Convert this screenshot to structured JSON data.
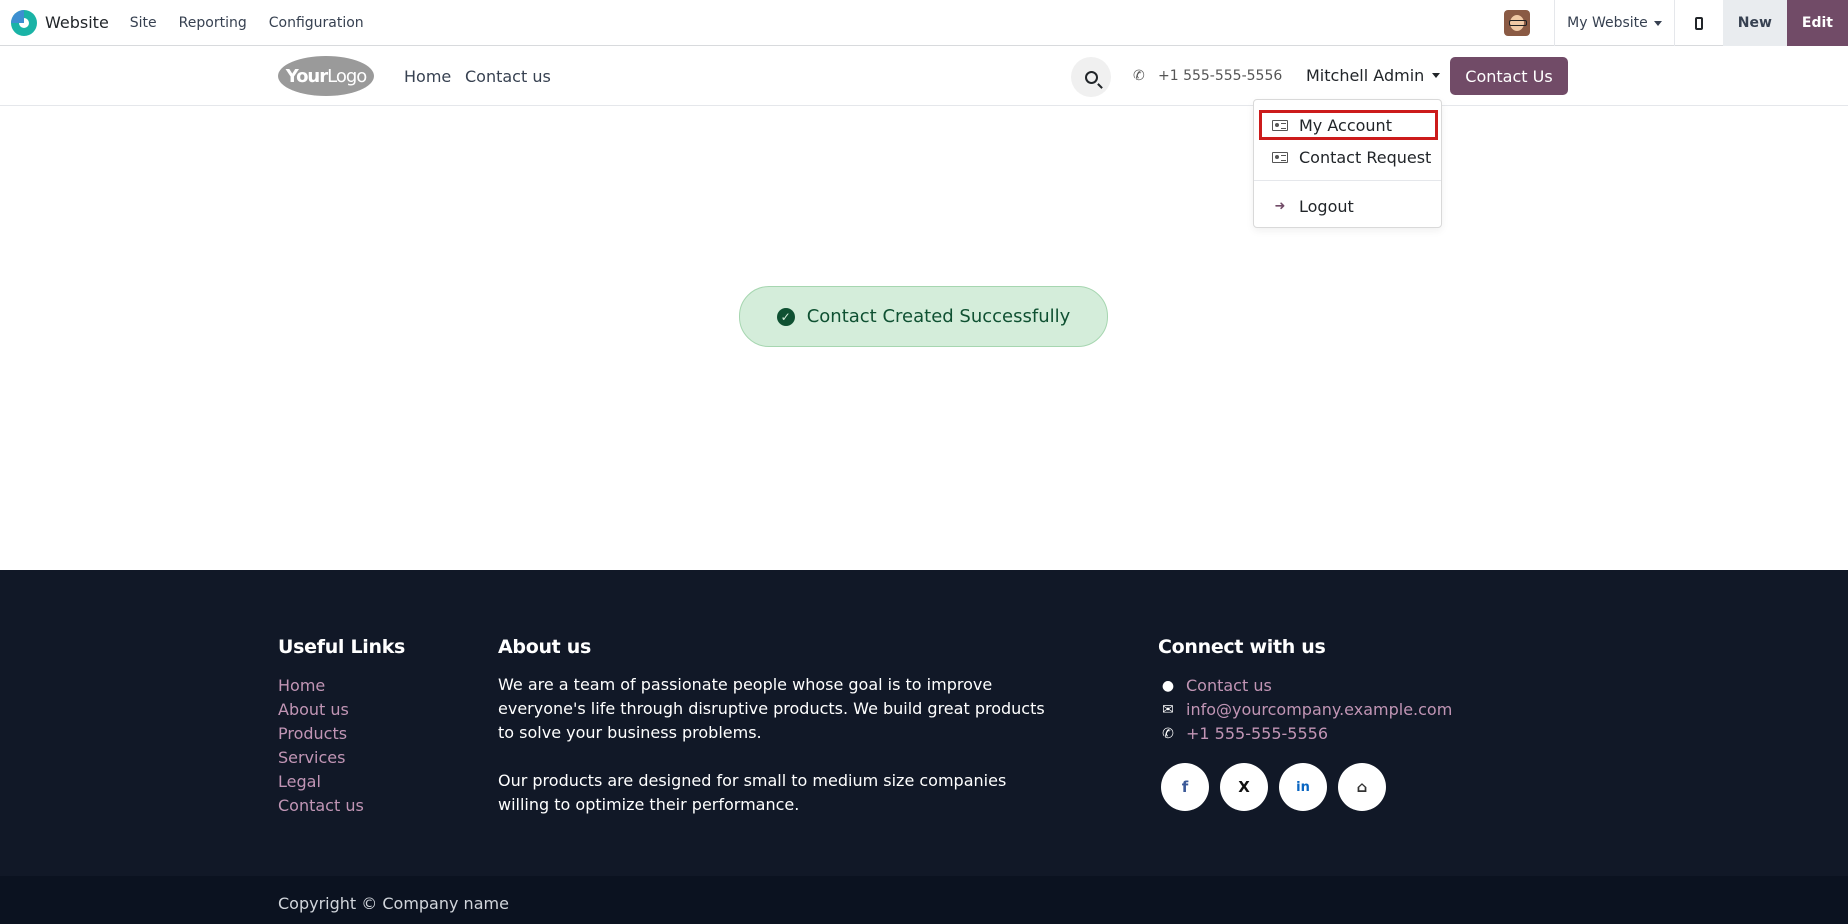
{
  "admin_bar": {
    "app_name": "Website",
    "menu": [
      "Site",
      "Reporting",
      "Configuration"
    ],
    "site_selector": "My Website",
    "new_label": "New",
    "edit_label": "Edit"
  },
  "header": {
    "logo_text_bold": "Your",
    "logo_text": "Logo",
    "nav": [
      "Home",
      "Contact us"
    ],
    "phone": "+1 555-555-5556",
    "user_name": "Mitchell Admin",
    "cta_label": "Contact Us"
  },
  "user_dropdown": {
    "items": [
      "My Account",
      "Contact Request"
    ],
    "logout": "Logout"
  },
  "alert": {
    "message": "Contact Created Successfully"
  },
  "footer": {
    "useful_links_title": "Useful Links",
    "useful_links": [
      "Home",
      "About us",
      "Products",
      "Services",
      "Legal",
      "Contact us"
    ],
    "about_title": "About us",
    "about_lines_1": [
      "We are a team of passionate people whose goal is to improve",
      "everyone's life through disruptive products. We build great products",
      "to solve your business problems."
    ],
    "about_lines_2": [
      "Our products are designed for small to medium size companies",
      "willing to optimize their performance."
    ],
    "connect_title": "Connect with us",
    "connect_links": [
      "Contact us",
      "info@yourcompany.example.com",
      "+1 555-555-5556"
    ],
    "social_icons": [
      "facebook-icon",
      "x-icon",
      "linkedin-icon",
      "home-icon"
    ],
    "copyright": "Copyright © Company name"
  },
  "colors": {
    "brand": "#714b67",
    "footer_bg": "#111827",
    "footer_link": "#c195b5",
    "alert_bg": "#d4edda",
    "highlight": "#cc1b1b"
  }
}
